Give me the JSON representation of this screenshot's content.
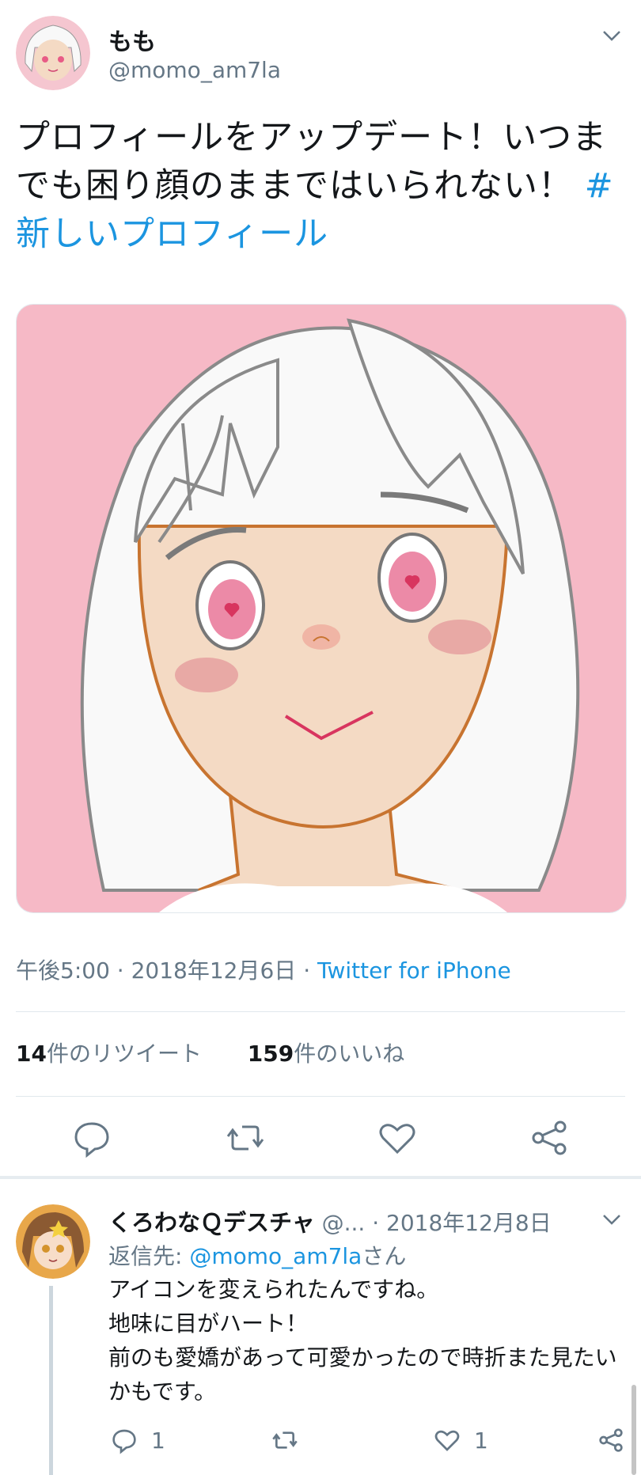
{
  "tweet": {
    "display_name": "もも",
    "handle": "@momo_am7la",
    "text": "プロフィールをアップデート！いつまでも困り顔のままではいられない！",
    "hashtag": "#新しいプロフィール",
    "time": "午後5:00",
    "date": "2018年12月6日",
    "source": "Twitter for iPhone",
    "dot": "·",
    "retweet_count": "14",
    "retweet_label": "件のリツイート",
    "like_count": "159",
    "like_label": "件のいいね"
  },
  "reply": {
    "display_name": "くろわなＱデスチャ",
    "handle": "@...",
    "date": "2018年12月8日",
    "dot": "·",
    "reply_to_label": "返信先:",
    "reply_to_handle": "@momo_am7la",
    "reply_to_suffix": "さん",
    "lines": [
      "アイコンを変えられたんですね。",
      "地味に目がハート！",
      "前のも愛嬌があって可愛かったので時折また見たいかもです。"
    ],
    "reply_count": "1",
    "like_count": "1"
  },
  "colors": {
    "accent": "#1b95e0",
    "secondary": "#657786",
    "pink_bg": "#f6b9c6"
  },
  "icons": [
    "chevron-down-icon",
    "reply-icon",
    "retweet-icon",
    "like-icon",
    "share-icon"
  ]
}
